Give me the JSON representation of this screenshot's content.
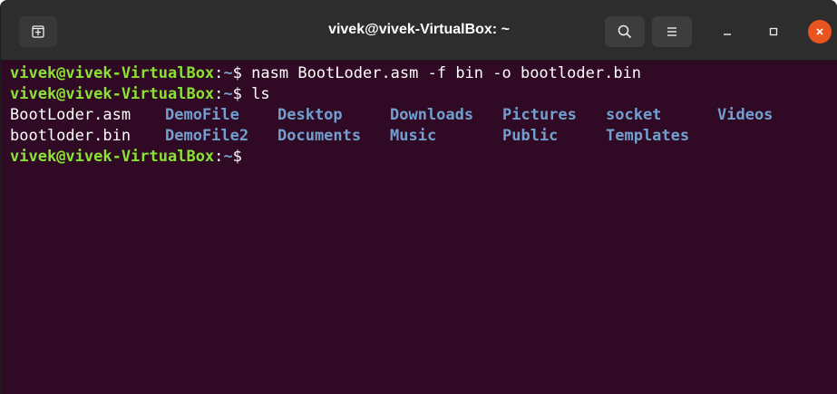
{
  "window": {
    "title": "vivek@vivek-VirtualBox: ~"
  },
  "toolbar": {
    "new_tab_icon": "new-tab-icon",
    "search_icon": "search-icon",
    "menu_icon": "hamburger-menu-icon",
    "minimize_icon": "minimize-icon",
    "maximize_icon": "maximize-icon",
    "close_icon": "close-icon"
  },
  "colors": {
    "terminal_bg": "#300a24",
    "titlebar_bg": "#2d2d2d",
    "prompt_user": "#8ae234",
    "prompt_path": "#729fcf",
    "directory": "#729fcf",
    "close_button": "#e95420"
  },
  "terminal": {
    "commands": [
      {
        "user": "vivek@vivek-VirtualBox",
        "sep": ":",
        "path": "~",
        "sym": "$ ",
        "cmd": "nasm BootLoder.asm -f bin -o bootloder.bin"
      },
      {
        "user": "vivek@vivek-VirtualBox",
        "sep": ":",
        "path": "~",
        "sym": "$ ",
        "cmd": "ls"
      }
    ],
    "ls_output": [
      [
        {
          "name": "BootLoder.asm",
          "type": "file"
        },
        {
          "name": "DemoFile",
          "type": "dir"
        },
        {
          "name": "Desktop",
          "type": "dir"
        },
        {
          "name": "Downloads",
          "type": "dir"
        },
        {
          "name": "Pictures",
          "type": "dir"
        },
        {
          "name": "socket",
          "type": "dir"
        },
        {
          "name": "Videos",
          "type": "dir"
        }
      ],
      [
        {
          "name": "bootloder.bin",
          "type": "file"
        },
        {
          "name": "DemoFile2",
          "type": "dir"
        },
        {
          "name": "Documents",
          "type": "dir"
        },
        {
          "name": "Music",
          "type": "dir"
        },
        {
          "name": "Public",
          "type": "dir"
        },
        {
          "name": "Templates",
          "type": "dir"
        }
      ]
    ],
    "final_prompt": {
      "user": "vivek@vivek-VirtualBox",
      "sep": ":",
      "path": "~",
      "sym": "$"
    }
  }
}
